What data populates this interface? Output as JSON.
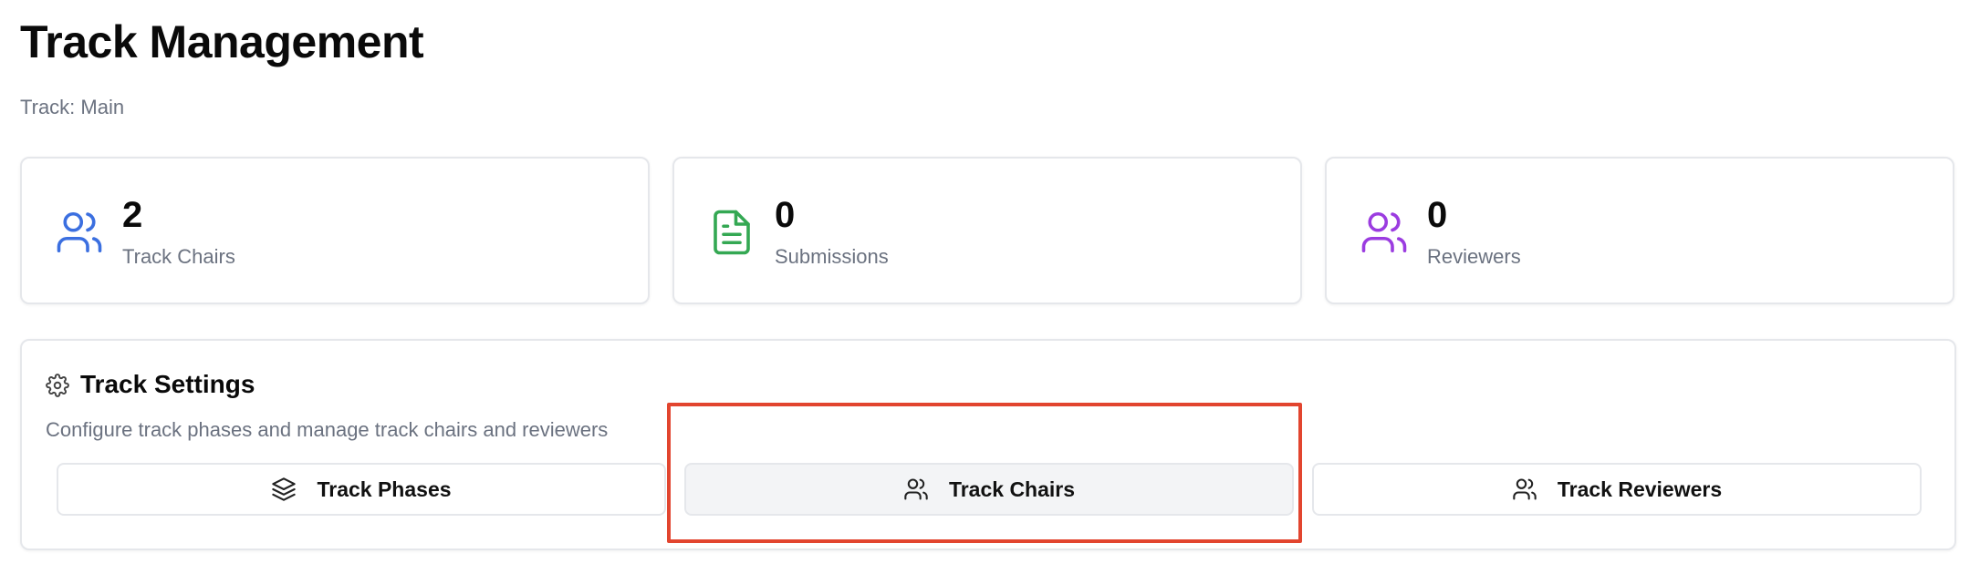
{
  "header": {
    "title": "Track Management",
    "subtitle": "Track: Main"
  },
  "stats": [
    {
      "value": "2",
      "label": "Track Chairs",
      "icon": "users-icon",
      "color": "#3b6fe0"
    },
    {
      "value": "0",
      "label": "Submissions",
      "icon": "document-icon",
      "color": "#34a853"
    },
    {
      "value": "0",
      "label": "Reviewers",
      "icon": "users-icon",
      "color": "#9b3ce0"
    }
  ],
  "settings": {
    "title": "Track Settings",
    "description": "Configure track phases and manage track chairs and reviewers",
    "icon": "gear-icon",
    "tabs": [
      {
        "label": "Track Phases",
        "icon": "layers-icon",
        "active": false
      },
      {
        "label": "Track Chairs",
        "icon": "users-icon",
        "active": true
      },
      {
        "label": "Track Reviewers",
        "icon": "users-icon",
        "active": false
      }
    ]
  },
  "colors": {
    "highlight": "#e2452f",
    "muted_text": "#6b7280",
    "border": "#e5e7eb"
  }
}
